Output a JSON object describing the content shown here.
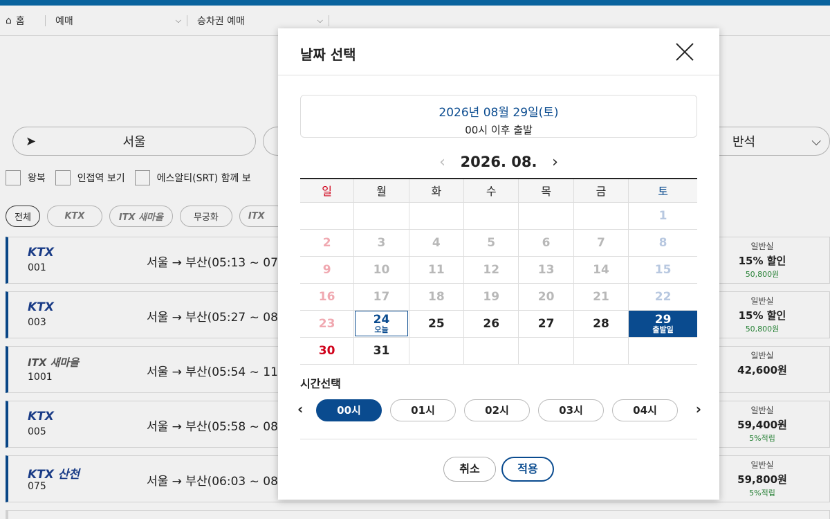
{
  "breadcrumb": {
    "home": "홈",
    "level1": "예매",
    "level2": "승차권 예매"
  },
  "search": {
    "from": "서울",
    "seat_class": "반석"
  },
  "options": [
    {
      "label": "왕복"
    },
    {
      "label": "인접역 보기"
    },
    {
      "label": "에스알티(SRT) 함께 보"
    }
  ],
  "filters": [
    "전체",
    "KTX",
    "ITX 새마을",
    "무궁화",
    "ITX"
  ],
  "trains": [
    {
      "brand": "KTX",
      "number": "001",
      "route": "서울 → 부산(05:13 ~ 07",
      "price_label": "일반실",
      "price": "15% 할인",
      "price_sub": "50,800원"
    },
    {
      "brand": "KTX",
      "number": "003",
      "route": "서울 → 부산(05:27 ~ 08",
      "price_label": "일반실",
      "price": "15% 할인",
      "price_sub": "50,800원"
    },
    {
      "brand": "ITX 새마을",
      "number": "1001",
      "route": "서울 → 부산(05:54 ~ 11",
      "price_label": "일반실",
      "price": "42,600원",
      "price_sub": ""
    },
    {
      "brand": "KTX",
      "number": "005",
      "route": "서울 → 부산(05:58 ~ 08",
      "price_label": "일반실",
      "price": "59,400원",
      "price_sub": "5%적립"
    },
    {
      "brand": "KTX 산천",
      "number": "075",
      "route": "서울 → 부산(06:03 ~ 08",
      "price_label": "일반실",
      "price": "59,800원",
      "price_sub": "5%적립"
    }
  ],
  "modal": {
    "title": "날짜 선택",
    "selected_date": "2026년 08월 29일(토)",
    "selected_time": "00시 이후 출발",
    "month": "2026. 08.",
    "weekdays": [
      "일",
      "월",
      "화",
      "수",
      "목",
      "금",
      "토"
    ],
    "today_label": "오늘",
    "selected_label": "출발일",
    "time_title": "시간선택",
    "time_options": [
      "00시",
      "01시",
      "02시",
      "03시",
      "04시"
    ],
    "active_time": "00시",
    "cancel_label": "취소",
    "apply_label": "적용",
    "calendar_weeks": [
      [
        "",
        "",
        "",
        "",
        "",
        "",
        "1"
      ],
      [
        "2",
        "3",
        "4",
        "5",
        "6",
        "7",
        "8"
      ],
      [
        "9",
        "10",
        "11",
        "12",
        "13",
        "14",
        "15"
      ],
      [
        "16",
        "17",
        "18",
        "19",
        "20",
        "21",
        "22"
      ],
      [
        "23",
        "24",
        "25",
        "26",
        "27",
        "28",
        "29"
      ],
      [
        "30",
        "31",
        "",
        "",
        "",
        "",
        ""
      ]
    ],
    "today_day": "24",
    "selected_day": "29"
  },
  "colors": {
    "accent": "#0a4b8f",
    "sunday": "#d0021b",
    "saturday": "#0a4b8f",
    "topbar": "#0a6aa8"
  }
}
